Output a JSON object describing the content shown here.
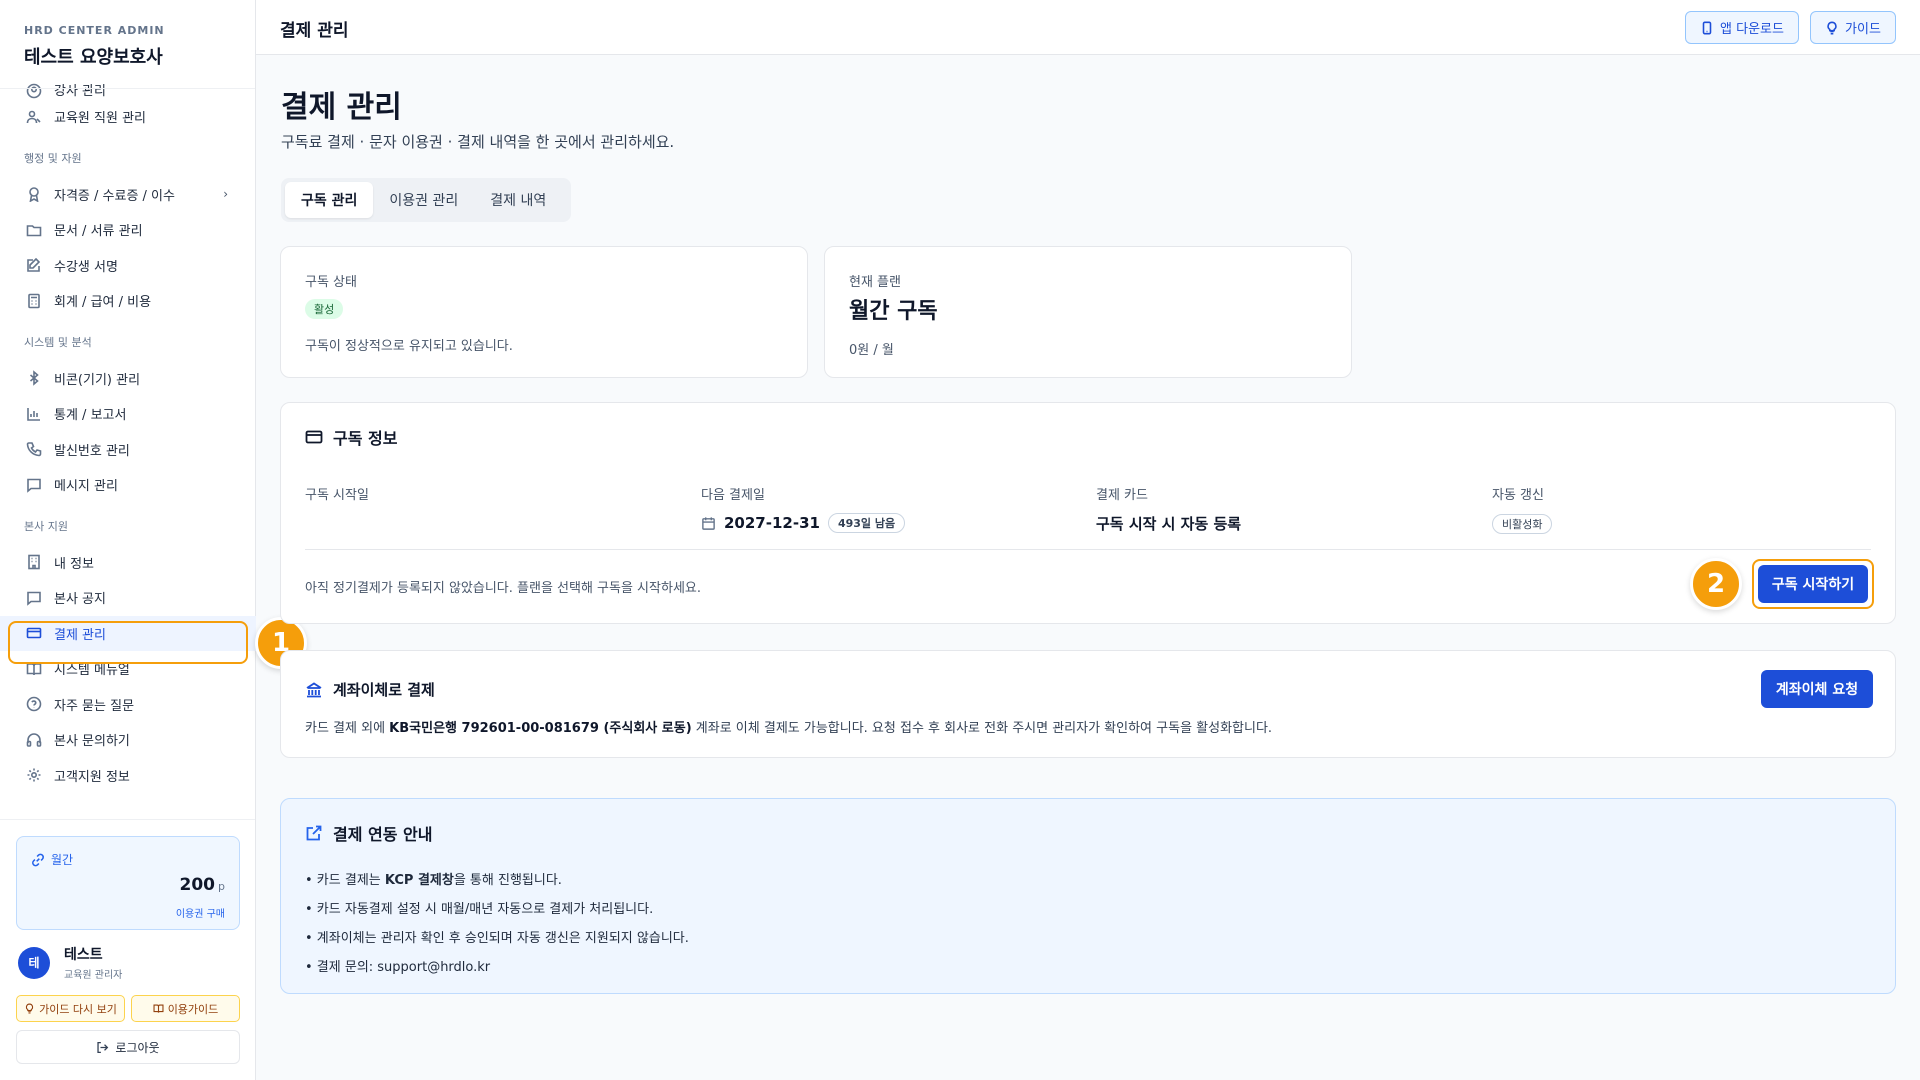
{
  "sidebar": {
    "brand_sub": "HRD CENTER ADMIN",
    "brand_title": "테스트 요양보호사",
    "items_top": [
      {
        "label": "강사 관리"
      },
      {
        "label": "교육원 직원 관리"
      }
    ],
    "group_admin": "행정 및 자원",
    "items_admin": [
      {
        "label": "자격증 / 수료증 / 이수"
      },
      {
        "label": "문서 / 서류 관리"
      },
      {
        "label": "수강생 서명"
      },
      {
        "label": "회계 / 급여 / 비용"
      }
    ],
    "group_system": "시스템 및 분석",
    "items_system": [
      {
        "label": "비콘(기기) 관리"
      },
      {
        "label": "통계 / 보고서"
      },
      {
        "label": "발신번호 관리"
      },
      {
        "label": "메시지 관리"
      }
    ],
    "group_hq": "본사 지원",
    "items_hq": [
      {
        "label": "내 정보"
      },
      {
        "label": "본사 공지"
      },
      {
        "label": "결제 관리"
      },
      {
        "label": "시스템 메뉴얼"
      },
      {
        "label": "자주 묻는 질문"
      },
      {
        "label": "본사 문의하기"
      },
      {
        "label": "고객지원 정보"
      }
    ],
    "point_card": {
      "label": "월간",
      "value": "200",
      "unit": "p",
      "buy": "이용권 구매"
    },
    "user": {
      "avatar": "테",
      "name": "테스트",
      "role": "교육원 관리자"
    },
    "guide_again": "가이드 다시 보기",
    "usage_guide": "이용가이드",
    "logout": "로그아웃"
  },
  "topbar": {
    "title": "결제 관리",
    "app_download": "앱 다운로드",
    "guide": "가이드"
  },
  "page": {
    "title": "결제 관리",
    "subtitle": "구독료 결제 · 문자 이용권 · 결제 내역을 한 곳에서 관리하세요.",
    "tabs": [
      {
        "label": "구독 관리"
      },
      {
        "label": "이용권 관리"
      },
      {
        "label": "결제 내역"
      }
    ]
  },
  "status_card": {
    "label": "구독 상태",
    "badge": "활성",
    "desc": "구독이 정상적으로 유지되고 있습니다."
  },
  "plan_card": {
    "label": "현재 플랜",
    "plan": "월간 구독",
    "price": "0원 / 월"
  },
  "sub_info": {
    "title": "구독 정보",
    "start_label": "구독 시작일",
    "next_label": "다음 결제일",
    "next_date": "2027-12-31",
    "remaining": "493일 남음",
    "card_label": "결제 카드",
    "card_value": "구독 시작 시 자동 등록",
    "renew_label": "자동 갱신",
    "renew_value": "비활성화",
    "notice": "아직 정기결제가 등록되지 않았습니다. 플랜을 선택해 구독을 시작하세요.",
    "start_button": "구독 시작하기"
  },
  "bank": {
    "title": "계좌이체로 결제",
    "button": "계좌이체 요청",
    "desc_pre": "카드 결제 외에 ",
    "desc_bold": "KB국민은행 792601-00-081679 (주식회사 로동)",
    "desc_post": " 계좌로 이체 결제도 가능합니다. 요청 접수 후 회사로 전화 주시면 관리자가 확인하여 구독을 활성화합니다."
  },
  "notice": {
    "title": "결제 연동 안내",
    "line1_pre": "• 카드 결제는 ",
    "line1_bold": "KCP 결제창",
    "line1_post": "을 통해 진행됩니다.",
    "line2": "• 카드 자동결제 설정 시 매월/매년 자동으로 결제가 처리됩니다.",
    "line3": "• 계좌이체는 관리자 확인 후 승인되며 자동 갱신은 지원되지 않습니다.",
    "line4": "• 결제 문의: support@hrdlo.kr"
  },
  "markers": {
    "one": "1",
    "two": "2"
  },
  "colors": {
    "accent": "#1d4ed8",
    "highlight": "#f59e0b",
    "active_badge": "#dcfce7"
  }
}
